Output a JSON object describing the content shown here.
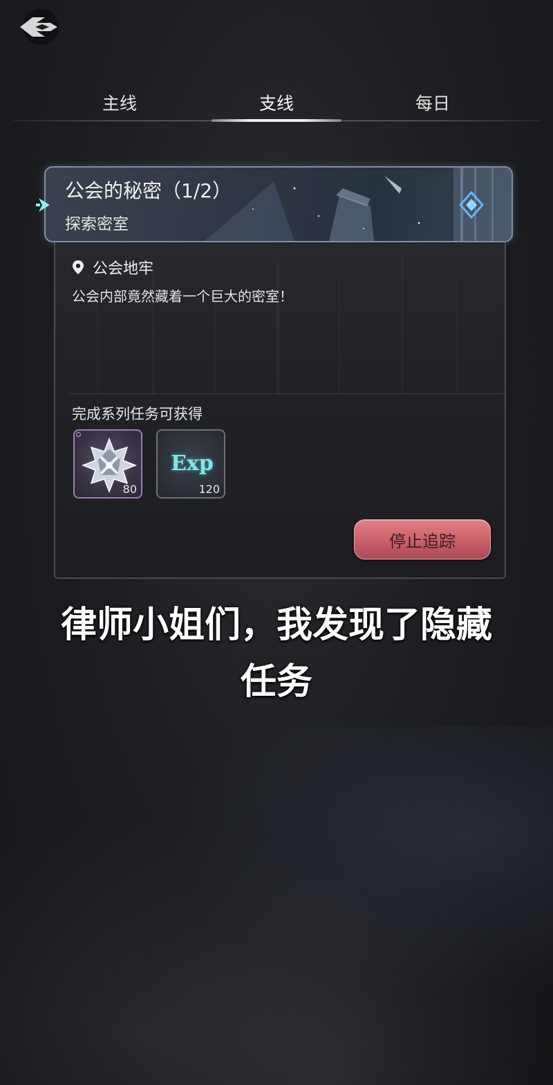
{
  "tabs": [
    {
      "label": "主线"
    },
    {
      "label": "支线"
    },
    {
      "label": "每日"
    }
  ],
  "active_tab": "支线",
  "quest": {
    "title": "公会的秘密（1/2）",
    "subtitle": "探索密室",
    "location": "公会地牢",
    "description": "公会内部竟然藏着一个巨大的密室！",
    "reward_heading": "完成系列任务可获得",
    "rewards": [
      {
        "icon": "star-emblem-icon",
        "quantity": "80"
      },
      {
        "icon": "exp-icon",
        "label": "Exp",
        "quantity": "120"
      }
    ],
    "stop_button": "停止追踪"
  },
  "caption": {
    "line1": "律师小姐们，我发现了隐藏",
    "line2": "任务"
  },
  "colors": {
    "accent_cyan": "#7fe6e6",
    "stop_button": "#c9606a",
    "reward_border_epic": "#9a7cb8"
  }
}
